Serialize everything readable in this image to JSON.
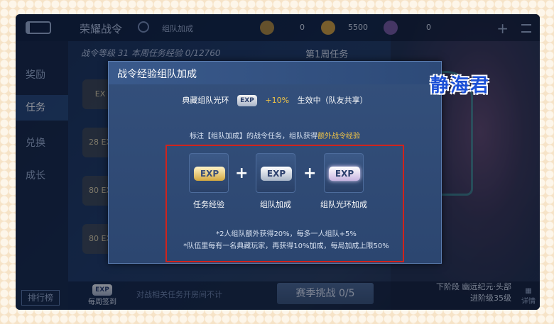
{
  "topbar": {
    "title": "荣耀战令",
    "sub": "组队加成",
    "currency1": "0",
    "currency2": "5500",
    "currency3": "0"
  },
  "sidebar": {
    "items": [
      {
        "label": "奖励"
      },
      {
        "label": "任务"
      },
      {
        "label": "兑换"
      },
      {
        "label": "成长"
      }
    ],
    "rank_label": "排行榜"
  },
  "background": {
    "level_text": "战令等级 31 本周任务经验 0/12760",
    "week_tab": "第1周任务",
    "tiles": [
      "EX",
      "28 EX",
      "80 EX",
      "80 EX"
    ],
    "weekly_sign": "每周签到",
    "bottom_note": "对战相关任务开房间不计",
    "season_button": "赛季挑战 0/5",
    "next_level_line1": "下阶段 幽远纪元·头部",
    "next_level_line2": "进阶级35级",
    "detail_label": "详情"
  },
  "modal": {
    "title": "战令经验组队加成",
    "aura_name": "典藏组队光环",
    "aura_bonus": "+10%",
    "aura_status": "生效中（队友共享）",
    "hint_prefix": "标注【组队加成】的战令任务，组队获得",
    "hint_highlight": "额外战令经验",
    "cards": [
      {
        "label": "任务经验",
        "badge": "EXP"
      },
      {
        "label": "组队加成",
        "badge": "EXP"
      },
      {
        "label": "组队光环加成",
        "badge": "EXP"
      }
    ],
    "operators": [
      "+",
      "+"
    ],
    "note1": "*2人组队额外获得20%，每多一人组队+5%",
    "note2": "*队伍里每有一名典藏玩家，再获得10%加成，每局加成上限50%"
  },
  "watermark": "静海君"
}
